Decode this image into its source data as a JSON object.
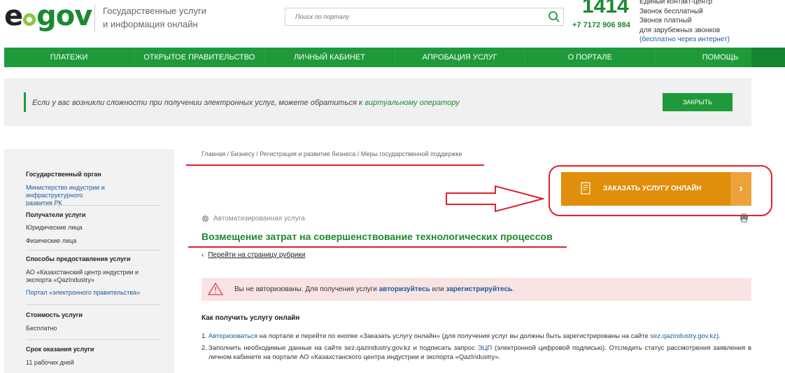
{
  "header": {
    "logo_e": "e",
    "logo_gov": "gov",
    "tagline_line1": "Государственные услуги",
    "tagline_line2": "и информация онлайн",
    "search_placeholder": "Поиск по порталу",
    "contact_number": "1414",
    "contact_phone": "+7 7172 906 984",
    "contact_line1": "Единый контакт-центр",
    "contact_line2": "Звонок бесплатный",
    "contact_line3": "Звонок платный",
    "contact_line4": "для зарубежных звонков",
    "contact_line5": "(бесплатно через интернет)"
  },
  "nav": {
    "items": [
      {
        "label": "Платежи"
      },
      {
        "label": "Открытое правительство"
      },
      {
        "label": "Личный кабинет"
      },
      {
        "label": "Апробация услуг"
      },
      {
        "label": "О портале"
      },
      {
        "label": "Помощь"
      }
    ]
  },
  "notice": {
    "text": "Если у вас возникли сложности при получении электронных услуг, можете обратиться к ",
    "link": "виртуальному оператору",
    "close_label": "Закрыть"
  },
  "sidebar": {
    "gov_body_title": "Государственный орган",
    "gov_body_line1": "Министерство индустрии и инфраструктурного",
    "gov_body_line2": "развития РК",
    "recipients_title": "Получатели услуги",
    "recipient1": "Юридические лица",
    "recipient2": "Физические лица",
    "methods_title": "Способы предоставления услуги",
    "method1_line1": "АО «Казахстанский центр индустрии и",
    "method1_line2": "экспорта «QazIndustry»",
    "method2": "Портал «электронного правительства»",
    "cost_title": "Стоимость услуги",
    "cost_value": "Бесплатно",
    "term_title": "Срок оказания услуги",
    "term_value": "11 рабочих дней"
  },
  "main": {
    "breadcrumb": "Главная / Бизнесу / Регистрация и развитие бизнеса / Меры государственной поддержки",
    "order_button": "Заказать услугу онлайн",
    "auto_label": "Автоматизированная услуга",
    "title": "Возмещение затрат на совершенствование технологических процессов",
    "back_link": "Перейти на страницу рубрики",
    "alert_text1": "Вы не авторизованы. Для получения услуги ",
    "alert_link1": "авторизуйтесь",
    "alert_text2": " или ",
    "alert_link2": "зарегистрируйтесь",
    "alert_text3": ".",
    "howto_title": "Как получить услугу онлайн",
    "step1_num": "1.",
    "step1_link": "Авторизоваться",
    "step1_text": " на портале и перейти по кнопке «Заказать услугу онлайн» (для получения услуг вы должны быть зарегистрированы на сайте ",
    "step1_link2": "sez.qazindustry.gov.kz",
    "step1_end": ").",
    "step2_num": "2.",
    "step2_text": "Заполнить необходимые данные на сайте sez.qazindustry.gov.kz и подписать запрос ",
    "step2_link": "ЭЦП",
    "step2_text2": " (электронной цифровой подписью). Отследить статус рассмотрения заявления в личном кабинете на портале АО «Казахстанского центра индустрии и экспорта «QazIndustry»."
  }
}
